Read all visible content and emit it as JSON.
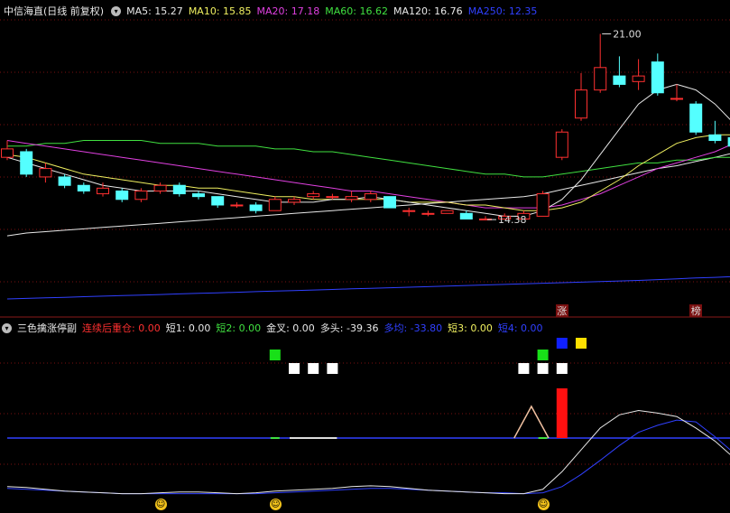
{
  "header": {
    "title": "中信海直(日线 前复权)",
    "indicators": [
      {
        "label": "MA5: 15.27",
        "color": "#e8e8e8"
      },
      {
        "label": "MA10: 15.85",
        "color": "#f0f060"
      },
      {
        "label": "MA20: 17.18",
        "color": "#e040e0"
      },
      {
        "label": "MA60: 16.62",
        "color": "#40e040"
      },
      {
        "label": "MA120: 16.76",
        "color": "#e8e8e8"
      },
      {
        "label": "MA250: 12.35",
        "color": "#3040ff"
      }
    ]
  },
  "subchart": {
    "title": "三色擒涨停副",
    "indicators": [
      {
        "label": "连续后重仓: 0.00",
        "color": "#ff3030"
      },
      {
        "label": "短1: 0.00",
        "color": "#e8e8e8"
      },
      {
        "label": "短2: 0.00",
        "color": "#40e040"
      },
      {
        "label": "金叉: 0.00",
        "color": "#e8e8e8"
      },
      {
        "label": "多头: -39.36",
        "color": "#e8e8e8"
      },
      {
        "label": "多均: -33.80",
        "color": "#3040ff"
      },
      {
        "label": "短3: 0.00",
        "color": "#f0f060"
      },
      {
        "label": "短4: 0.00",
        "color": "#3040ff"
      }
    ]
  },
  "price_annotations": {
    "high": "21.00",
    "low": "14.38"
  },
  "badges": [
    {
      "name": "limit-up-badge",
      "text": "涨",
      "x_index": 29
    },
    {
      "name": "list-badge",
      "text": "榜",
      "x_index": 36
    }
  ],
  "colors": {
    "up": "#ff3030",
    "down": "#54ffff",
    "grid": "#7a1010",
    "background": "#000000"
  },
  "chart_data": {
    "type": "candlestick",
    "candles": [
      {
        "o": 16.6,
        "c": 16.9,
        "h": 17.2,
        "l": 16.5
      },
      {
        "o": 16.8,
        "c": 16.0,
        "h": 16.9,
        "l": 15.9
      },
      {
        "o": 15.9,
        "c": 16.2,
        "h": 16.4,
        "l": 15.7
      },
      {
        "o": 15.9,
        "c": 15.6,
        "h": 16.0,
        "l": 15.5
      },
      {
        "o": 15.6,
        "c": 15.4,
        "h": 15.7,
        "l": 15.3
      },
      {
        "o": 15.3,
        "c": 15.5,
        "h": 15.7,
        "l": 15.2
      },
      {
        "o": 15.4,
        "c": 15.1,
        "h": 15.5,
        "l": 15.0
      },
      {
        "o": 15.1,
        "c": 15.4,
        "h": 15.5,
        "l": 15.0
      },
      {
        "o": 15.4,
        "c": 15.6,
        "h": 15.7,
        "l": 15.3
      },
      {
        "o": 15.6,
        "c": 15.3,
        "h": 15.7,
        "l": 15.2
      },
      {
        "o": 15.3,
        "c": 15.2,
        "h": 15.4,
        "l": 15.1
      },
      {
        "o": 15.2,
        "c": 14.9,
        "h": 15.2,
        "l": 14.8
      },
      {
        "o": 14.9,
        "c": 14.9,
        "h": 15.0,
        "l": 14.8
      },
      {
        "o": 14.9,
        "c": 14.7,
        "h": 15.0,
        "l": 14.6
      },
      {
        "o": 14.7,
        "c": 15.1,
        "h": 15.2,
        "l": 14.7
      },
      {
        "o": 15.0,
        "c": 15.1,
        "h": 15.2,
        "l": 14.9
      },
      {
        "o": 15.2,
        "c": 15.3,
        "h": 15.4,
        "l": 15.1
      },
      {
        "o": 15.2,
        "c": 15.2,
        "h": 15.3,
        "l": 15.1
      },
      {
        "o": 15.1,
        "c": 15.2,
        "h": 15.4,
        "l": 15.0
      },
      {
        "o": 15.1,
        "c": 15.3,
        "h": 15.4,
        "l": 15.0
      },
      {
        "o": 15.2,
        "c": 14.8,
        "h": 15.2,
        "l": 14.8
      },
      {
        "o": 14.7,
        "c": 14.7,
        "h": 14.8,
        "l": 14.5
      },
      {
        "o": 14.6,
        "c": 14.6,
        "h": 14.7,
        "l": 14.5
      },
      {
        "o": 14.6,
        "c": 14.7,
        "h": 14.7,
        "l": 14.6
      },
      {
        "o": 14.6,
        "c": 14.4,
        "h": 14.7,
        "l": 14.4
      },
      {
        "o": 14.4,
        "c": 14.4,
        "h": 14.5,
        "l": 14.38
      },
      {
        "o": 14.4,
        "c": 14.5,
        "h": 14.6,
        "l": 14.38
      },
      {
        "o": 14.4,
        "c": 14.6,
        "h": 14.7,
        "l": 14.4
      },
      {
        "o": 14.5,
        "c": 15.3,
        "h": 15.4,
        "l": 14.5
      },
      {
        "o": 16.6,
        "c": 17.5,
        "h": 17.6,
        "l": 16.5
      },
      {
        "o": 18.0,
        "c": 19.0,
        "h": 19.6,
        "l": 17.9
      },
      {
        "o": 19.0,
        "c": 19.8,
        "h": 21.0,
        "l": 18.9
      },
      {
        "o": 19.5,
        "c": 19.2,
        "h": 20.2,
        "l": 19.1
      },
      {
        "o": 19.3,
        "c": 19.5,
        "h": 20.1,
        "l": 19.0
      },
      {
        "o": 20.0,
        "c": 18.9,
        "h": 20.3,
        "l": 18.8
      },
      {
        "o": 18.7,
        "c": 18.7,
        "h": 19.2,
        "l": 18.6
      },
      {
        "o": 18.5,
        "c": 17.5,
        "h": 18.6,
        "l": 17.4
      },
      {
        "o": 17.4,
        "c": 17.2,
        "h": 17.9,
        "l": 17.1
      },
      {
        "o": 17.3,
        "c": 17.0,
        "h": 17.4,
        "l": 16.9
      }
    ],
    "ma5": [
      16.6,
      16.4,
      16.2,
      16.0,
      15.8,
      15.6,
      15.5,
      15.4,
      15.4,
      15.4,
      15.4,
      15.3,
      15.2,
      15.1,
      15.0,
      15.0,
      15.0,
      15.1,
      15.1,
      15.2,
      15.1,
      15.0,
      14.9,
      14.8,
      14.7,
      14.6,
      14.5,
      14.5,
      14.7,
      15.1,
      15.8,
      16.7,
      17.6,
      18.5,
      19.0,
      19.2,
      19.0,
      18.5,
      17.8
    ],
    "ma10": [
      16.7,
      16.6,
      16.4,
      16.2,
      16.0,
      15.9,
      15.8,
      15.7,
      15.6,
      15.6,
      15.5,
      15.5,
      15.4,
      15.3,
      15.2,
      15.2,
      15.1,
      15.1,
      15.1,
      15.1,
      15.1,
      15.0,
      15.0,
      15.0,
      14.9,
      14.9,
      14.8,
      14.7,
      14.7,
      14.8,
      15.0,
      15.4,
      15.8,
      16.3,
      16.7,
      17.1,
      17.3,
      17.4,
      17.4
    ],
    "ma20": [
      17.2,
      17.1,
      17.0,
      16.9,
      16.8,
      16.7,
      16.6,
      16.5,
      16.4,
      16.3,
      16.2,
      16.1,
      16.0,
      15.9,
      15.8,
      15.7,
      15.6,
      15.5,
      15.4,
      15.4,
      15.3,
      15.2,
      15.1,
      15.0,
      14.9,
      14.8,
      14.8,
      14.8,
      14.8,
      14.9,
      15.1,
      15.3,
      15.6,
      15.9,
      16.2,
      16.4,
      16.6,
      16.8,
      17.1
    ],
    "ma60": [
      17.0,
      17.0,
      17.1,
      17.1,
      17.2,
      17.2,
      17.2,
      17.2,
      17.1,
      17.1,
      17.1,
      17.0,
      17.0,
      17.0,
      16.9,
      16.9,
      16.8,
      16.8,
      16.7,
      16.6,
      16.5,
      16.4,
      16.3,
      16.2,
      16.1,
      16.0,
      16.0,
      15.9,
      15.9,
      16.0,
      16.1,
      16.2,
      16.3,
      16.4,
      16.4,
      16.5,
      16.5,
      16.6,
      16.6
    ],
    "ma120": [
      13.8,
      13.9,
      13.95,
      14.0,
      14.05,
      14.1,
      14.15,
      14.2,
      14.25,
      14.3,
      14.35,
      14.4,
      14.45,
      14.5,
      14.55,
      14.6,
      14.65,
      14.7,
      14.75,
      14.8,
      14.85,
      14.9,
      14.95,
      15.0,
      15.05,
      15.1,
      15.15,
      15.2,
      15.3,
      15.45,
      15.6,
      15.75,
      15.9,
      16.05,
      16.2,
      16.3,
      16.45,
      16.6,
      16.76
    ],
    "ma250": [
      11.55,
      11.57,
      11.59,
      11.61,
      11.63,
      11.65,
      11.67,
      11.69,
      11.71,
      11.73,
      11.75,
      11.77,
      11.79,
      11.81,
      11.83,
      11.85,
      11.87,
      11.89,
      11.91,
      11.93,
      11.95,
      11.97,
      11.99,
      12.01,
      12.03,
      12.05,
      12.07,
      12.09,
      12.11,
      12.13,
      12.15,
      12.17,
      12.19,
      12.21,
      12.24,
      12.27,
      12.3,
      12.32,
      12.35
    ],
    "duotou": [
      -72,
      -73,
      -75,
      -77,
      -78,
      -79,
      -80,
      -80,
      -79,
      -78,
      -78,
      -79,
      -80,
      -79,
      -77,
      -76,
      -75,
      -74,
      -72,
      -71,
      -72,
      -74,
      -76,
      -77,
      -78,
      -79,
      -80,
      -80,
      -75,
      -55,
      -30,
      -5,
      10,
      15,
      12,
      8,
      -5,
      -20,
      -39.36
    ],
    "duojun": [
      -74,
      -75,
      -76,
      -77,
      -78,
      -79,
      -80,
      -80,
      -80,
      -80,
      -80,
      -80,
      -80,
      -80,
      -79,
      -78,
      -77,
      -76,
      -75,
      -74,
      -74,
      -75,
      -76,
      -77,
      -78,
      -79,
      -79,
      -80,
      -79,
      -72,
      -58,
      -42,
      -25,
      -10,
      -2,
      4,
      2,
      -15,
      -33.8
    ],
    "signals": {
      "white_squares": [
        15,
        16,
        17,
        27,
        28,
        29
      ],
      "green_squares": [
        14,
        28
      ],
      "blue_squares": [
        29
      ],
      "yellow_squares": [
        30
      ],
      "red_bar": {
        "index": 29,
        "value": 100
      },
      "smile_markers": [
        8,
        14,
        28
      ]
    }
  }
}
